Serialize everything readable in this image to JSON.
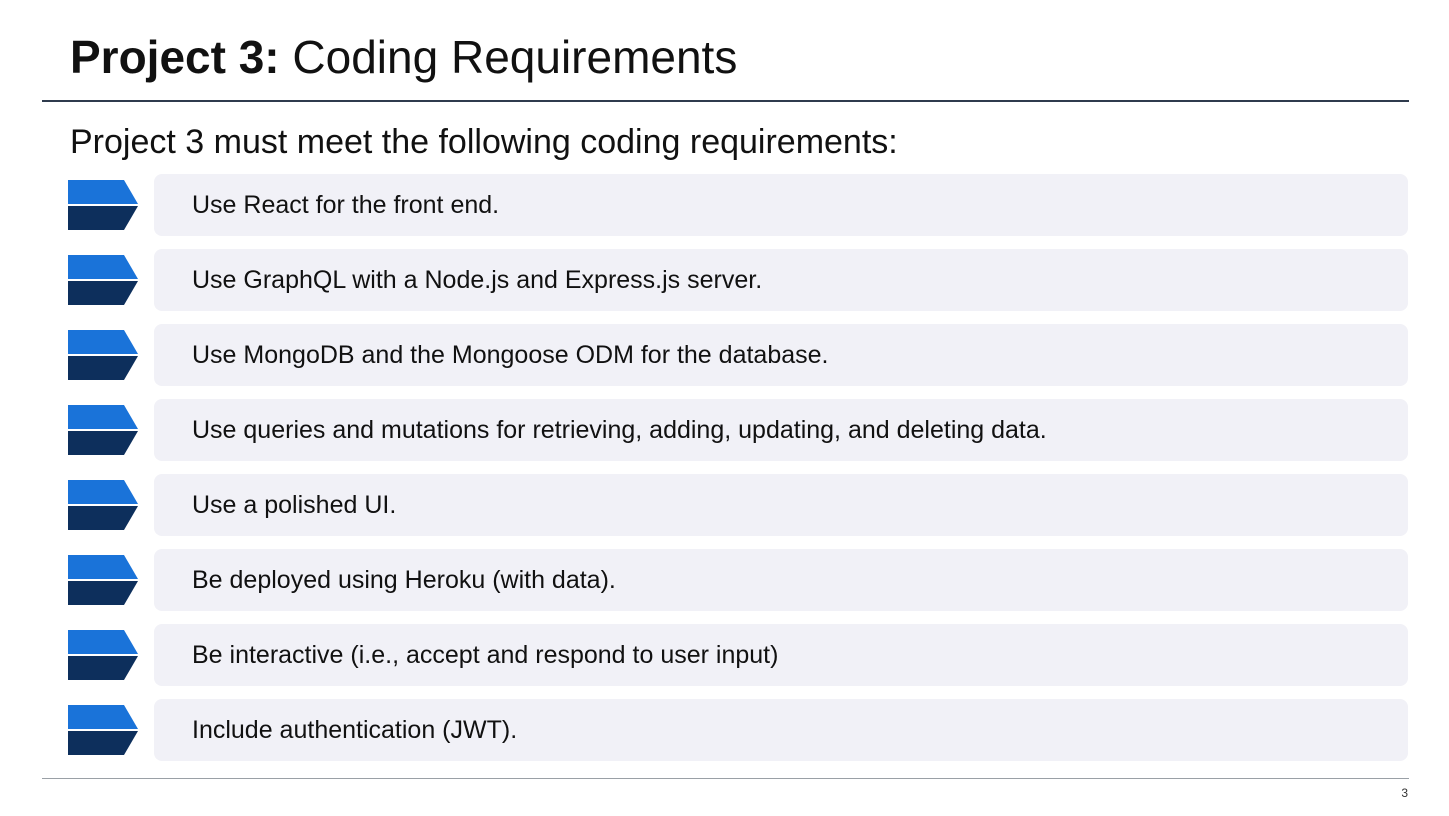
{
  "title": {
    "bold": "Project 3:",
    "light": "Coding Requirements"
  },
  "subtitle": "Project 3 must meet the following coding requirements:",
  "requirements": [
    "Use React for the front end.",
    "Use GraphQL with a Node.js and Express.js server.",
    "Use MongoDB and the Mongoose ODM for the database.",
    "Use queries and mutations for retrieving, adding, updating, and deleting data.",
    "Use a polished UI.",
    "Be deployed using Heroku (with data).",
    "Be interactive (i.e., accept and respond to user input)",
    "Include authentication (JWT)."
  ],
  "page_number": "3",
  "colors": {
    "chevron_light": "#1a73d9",
    "chevron_dark": "#0d2f5c",
    "box_bg": "#f1f1f7",
    "rule": "#2f3b4d"
  },
  "icons": {
    "bullet": "chevron-arrow-icon"
  }
}
